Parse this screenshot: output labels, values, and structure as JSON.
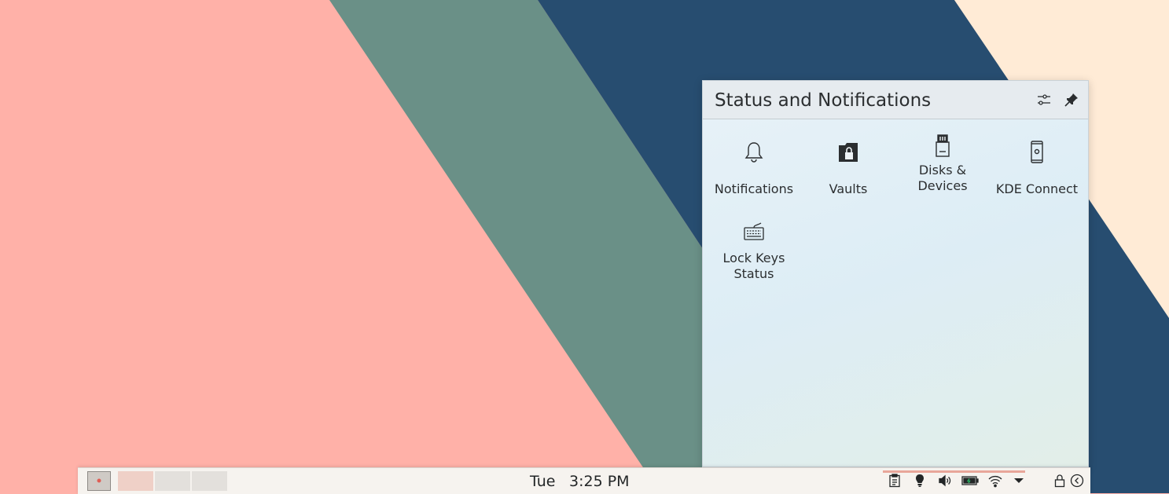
{
  "panel": {
    "title": "Status and Notifications",
    "configure_icon": "configure-icon",
    "pin_icon": "pin-icon",
    "items": [
      {
        "label": "Notifications",
        "icon": "bell-icon"
      },
      {
        "label": "Vaults",
        "icon": "vault-icon"
      },
      {
        "label": "Disks & Devices",
        "icon": "disk-icon"
      },
      {
        "label": "KDE Connect",
        "icon": "phone-icon"
      },
      {
        "label": "Lock Keys Status",
        "icon": "keyboard-icon"
      }
    ]
  },
  "taskbar": {
    "day": "Tue",
    "time": "3:25 PM",
    "tray": [
      "clipboard-icon",
      "bulb-icon",
      "volume-icon",
      "battery-icon",
      "wifi-icon",
      "expand-arrow-icon",
      "lock-icon",
      "logout-icon"
    ]
  },
  "colors": {
    "wallpaper_pink": "#ffb1a8",
    "wallpaper_teal": "#6a9087",
    "wallpaper_navy": "#274d70",
    "wallpaper_cream": "#ffebd6"
  }
}
